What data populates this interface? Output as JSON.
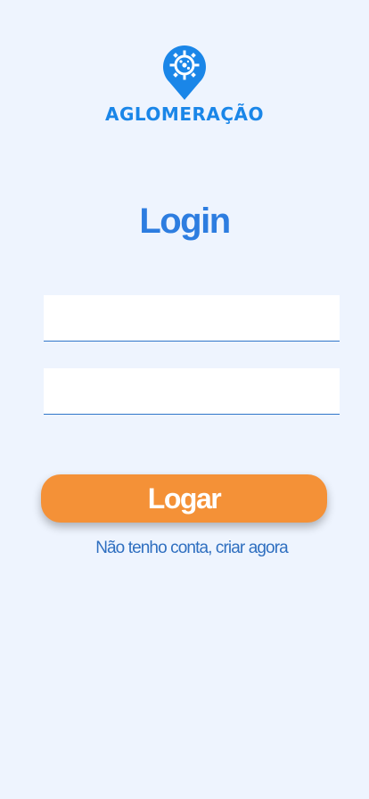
{
  "app": {
    "logo_text": "AGLOMERAÇÃO",
    "logo_icon": "virus-location-pin-icon"
  },
  "login": {
    "title": "Login",
    "username_value": "",
    "password_value": "",
    "submit_label": "Logar",
    "signup_link": "Não tenho conta, criar agora"
  },
  "colors": {
    "background": "#eef4fe",
    "brand_blue": "#1a86e8",
    "title_blue": "#2d7de0",
    "button_orange": "#f49137",
    "link_blue": "#2f6fc0"
  }
}
